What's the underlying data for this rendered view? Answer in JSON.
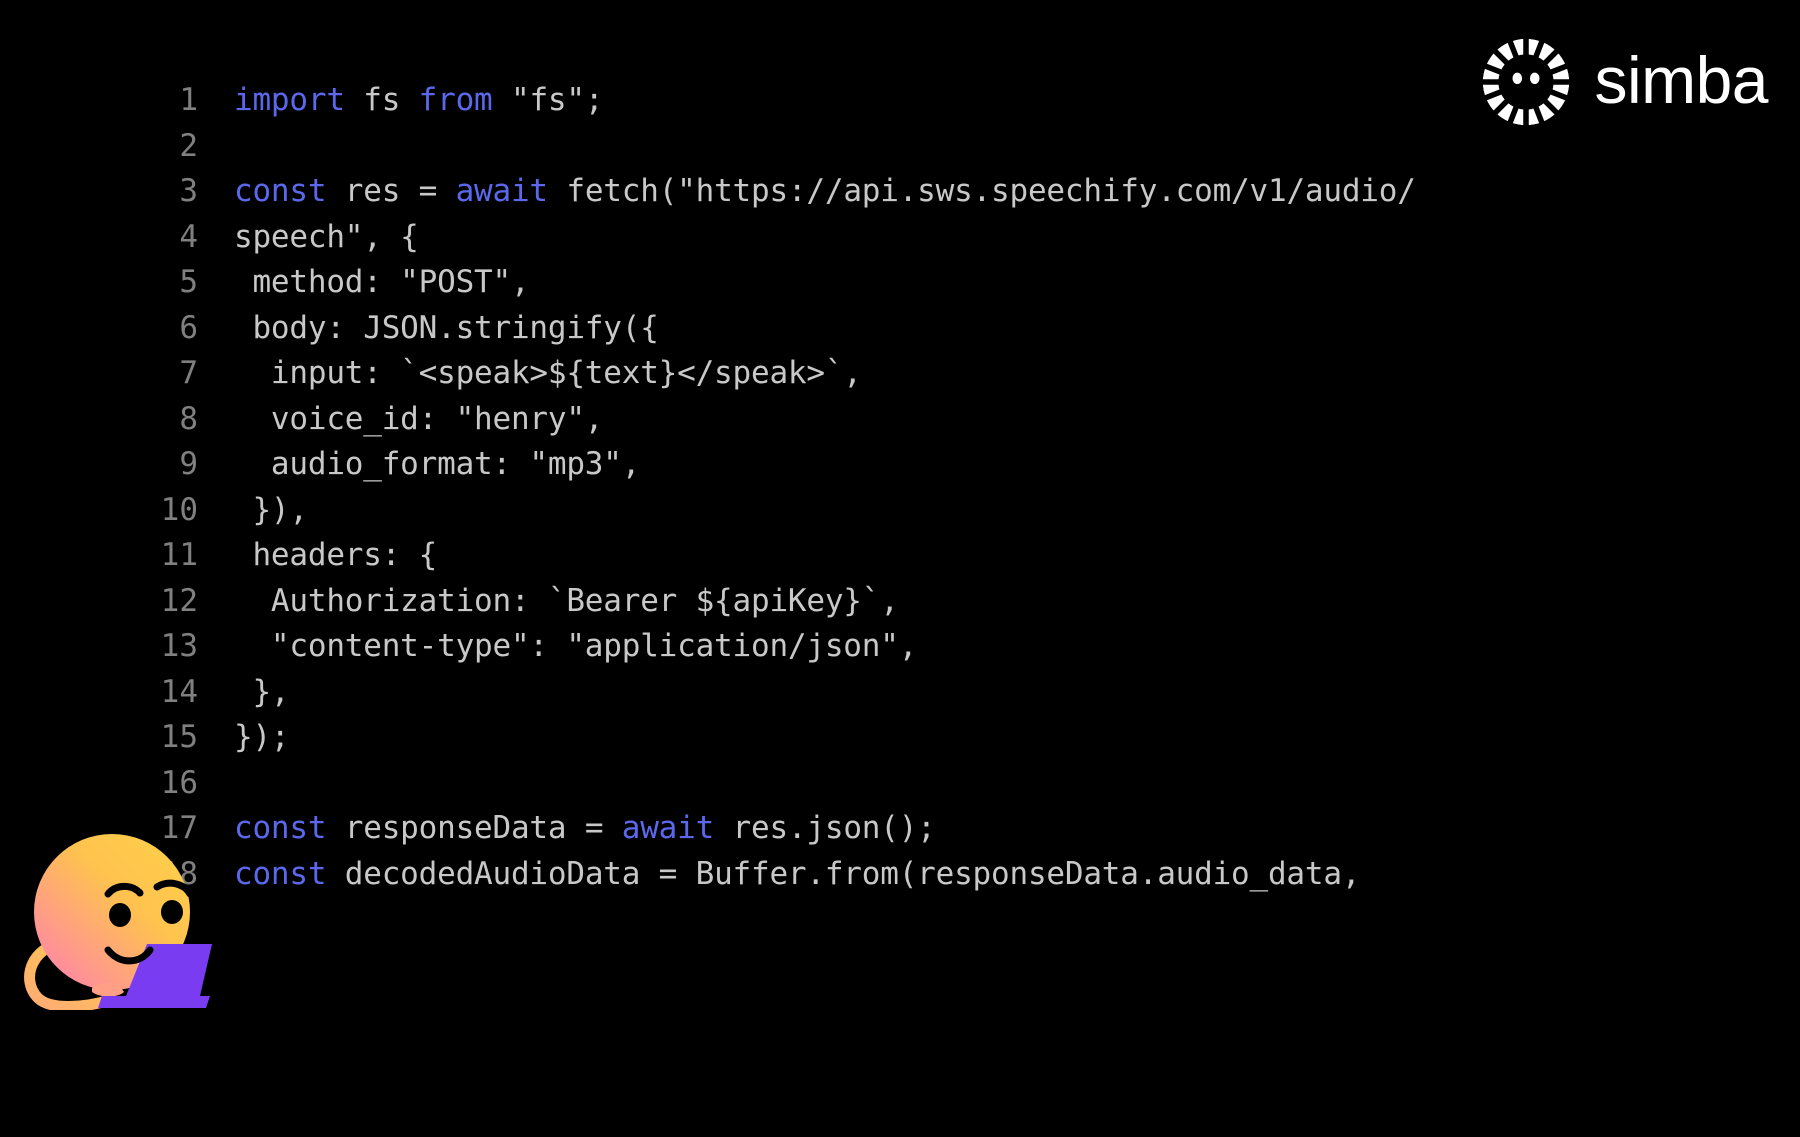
{
  "brand": {
    "wordmark": "simba",
    "logo_icon": "simba-sun-lion-mark",
    "logo_color": "#ffffff"
  },
  "editor": {
    "background": "#000000",
    "default_text_color": "#c8c8c8",
    "line_number_color": "#808080",
    "keyword_color": "#5b68ec",
    "language": "javascript",
    "first_line_number": 1,
    "last_line_number": 18,
    "total_lines": 18,
    "lines": [
      {
        "number": "1",
        "segments": [
          {
            "t": "import",
            "k": true
          },
          {
            "t": " fs ",
            "k": false
          },
          {
            "t": "from",
            "k": true
          },
          {
            "t": " \"fs\";",
            "k": false
          }
        ]
      },
      {
        "number": "2",
        "segments": [
          {
            "t": "",
            "k": false
          }
        ]
      },
      {
        "number": "3",
        "segments": [
          {
            "t": "const",
            "k": true
          },
          {
            "t": " res = ",
            "k": false
          },
          {
            "t": "await",
            "k": true
          },
          {
            "t": " fetch(\"https://api.sws.speechify.com/v1/audio/",
            "k": false
          }
        ]
      },
      {
        "number": "4",
        "segments": [
          {
            "t": "speech\", {",
            "k": false
          }
        ]
      },
      {
        "number": "5",
        "segments": [
          {
            "t": " method: \"POST\",",
            "k": false
          }
        ]
      },
      {
        "number": "6",
        "segments": [
          {
            "t": " body: JSON.stringify({",
            "k": false
          }
        ]
      },
      {
        "number": "7",
        "segments": [
          {
            "t": "  input: `<speak>${text}</speak>`,",
            "k": false
          }
        ]
      },
      {
        "number": "8",
        "segments": [
          {
            "t": "  voice_id: \"henry\",",
            "k": false
          }
        ]
      },
      {
        "number": "9",
        "segments": [
          {
            "t": "  audio_format: \"mp3\",",
            "k": false
          }
        ]
      },
      {
        "number": "10",
        "segments": [
          {
            "t": " }),",
            "k": false
          }
        ]
      },
      {
        "number": "11",
        "segments": [
          {
            "t": " headers: {",
            "k": false
          }
        ]
      },
      {
        "number": "12",
        "segments": [
          {
            "t": "  Authorization: `Bearer ${apiKey}`,",
            "k": false
          }
        ]
      },
      {
        "number": "13",
        "segments": [
          {
            "t": "  \"content-type\": \"application/json\",",
            "k": false
          }
        ]
      },
      {
        "number": "14",
        "segments": [
          {
            "t": " },",
            "k": false
          }
        ]
      },
      {
        "number": "15",
        "segments": [
          {
            "t": "});",
            "k": false
          }
        ]
      },
      {
        "number": "16",
        "segments": [
          {
            "t": "",
            "k": false
          }
        ]
      },
      {
        "number": "17",
        "segments": [
          {
            "t": "const",
            "k": true
          },
          {
            "t": " responseData = ",
            "k": false
          },
          {
            "t": "await",
            "k": true
          },
          {
            "t": " res.json();",
            "k": false
          }
        ]
      },
      {
        "number": "18",
        "segments": [
          {
            "t": "const",
            "k": true
          },
          {
            "t": " decodedAudioData = Buffer.from(responseData.audio_data,",
            "k": false
          }
        ]
      }
    ]
  },
  "mascot": {
    "icon": "smirking-face-with-laptop-mascot",
    "face_gradient_from": "#ffd04a",
    "face_gradient_to": "#ff7fb0",
    "laptop_color": "#7a3cf0",
    "feature_color": "#000000"
  }
}
